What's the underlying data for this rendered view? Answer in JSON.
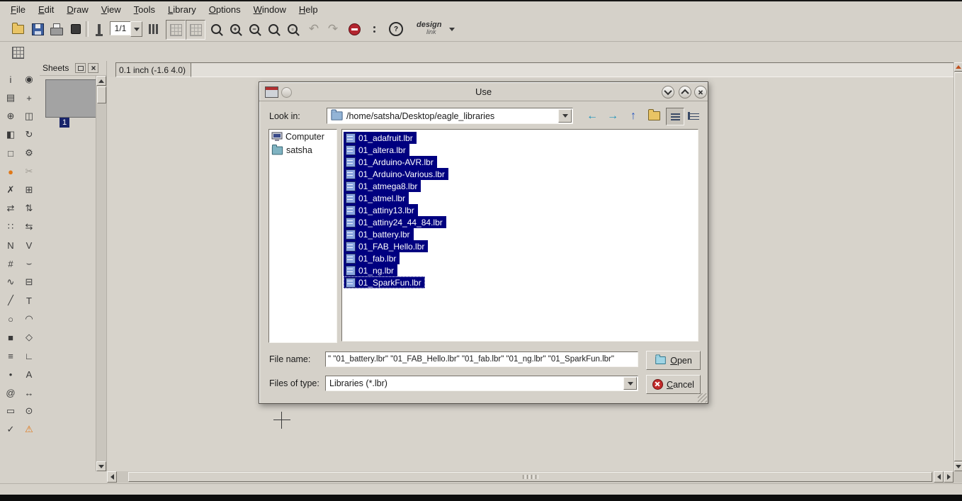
{
  "app": {
    "menubar": [
      "File",
      "Edit",
      "Draw",
      "View",
      "Tools",
      "Library",
      "Options",
      "Window",
      "Help"
    ],
    "toolbar": {
      "sheet_combo": "1/1",
      "zoom_subs": {
        "fit": "",
        "in": "+",
        "out": "−",
        "select": "▫",
        "redraw": ""
      },
      "undo_glyph": "↶",
      "redo_glyph": "↷",
      "help_glyph": "?",
      "brand_line1": "design",
      "brand_line2": "link"
    },
    "sheets_panel": {
      "title": "Sheets",
      "sheet_number": "1"
    },
    "command_bar": {
      "coordinates": "0.1 inch (-1.6 4.0)",
      "command_value": ""
    },
    "palette_tools": [
      {
        "name": "info-tool",
        "glyph": "i"
      },
      {
        "name": "show-tool",
        "glyph": "◉"
      },
      {
        "name": "display-tool",
        "glyph": "▤"
      },
      {
        "name": "mark-tool",
        "glyph": "+"
      },
      {
        "name": "move-tool",
        "glyph": "⊕"
      },
      {
        "name": "copy-tool",
        "glyph": "◫"
      },
      {
        "name": "mirror-tool",
        "glyph": "◧"
      },
      {
        "name": "rotate-tool",
        "glyph": "↻"
      },
      {
        "name": "group-tool",
        "glyph": "□"
      },
      {
        "name": "change-tool",
        "glyph": "⚙"
      },
      {
        "name": "paint-tool",
        "glyph": "●",
        "color": "#e07818"
      },
      {
        "name": "cut-tool",
        "glyph": "✂",
        "disabled": true
      },
      {
        "name": "delete-tool",
        "glyph": "✗"
      },
      {
        "name": "add-tool",
        "glyph": "⊞"
      },
      {
        "name": "pinswap-tool",
        "glyph": "⇄"
      },
      {
        "name": "gateswap-tool",
        "glyph": "⇅"
      },
      {
        "name": "array-tool",
        "glyph": "∷"
      },
      {
        "name": "replace-tool",
        "glyph": "⇆"
      },
      {
        "name": "name-tool",
        "glyph": "N"
      },
      {
        "name": "value-tool",
        "glyph": "V"
      },
      {
        "name": "smash-tool",
        "glyph": "#"
      },
      {
        "name": "miter-tool",
        "glyph": "⌣"
      },
      {
        "name": "split-tool",
        "glyph": "∿"
      },
      {
        "name": "invoke-tool",
        "glyph": "⊟"
      },
      {
        "name": "wire-tool",
        "glyph": "╱"
      },
      {
        "name": "text-tool",
        "glyph": "T"
      },
      {
        "name": "circle-tool",
        "glyph": "○"
      },
      {
        "name": "arc-tool",
        "glyph": "◠"
      },
      {
        "name": "rect-tool",
        "glyph": "■"
      },
      {
        "name": "polygon-tool",
        "glyph": "◇"
      },
      {
        "name": "bus-tool",
        "glyph": "≡"
      },
      {
        "name": "net-tool",
        "glyph": "∟"
      },
      {
        "name": "junction-tool",
        "glyph": "•"
      },
      {
        "name": "label-tool",
        "glyph": "A"
      },
      {
        "name": "attribute-tool",
        "glyph": "@"
      },
      {
        "name": "dimension-tool",
        "glyph": "↔"
      },
      {
        "name": "frame-tool",
        "glyph": "▭"
      },
      {
        "name": "port-tool",
        "glyph": "⊙"
      },
      {
        "name": "erc-tool",
        "glyph": "✓"
      },
      {
        "name": "errors-tool",
        "glyph": "⚠",
        "color": "#e07818"
      }
    ]
  },
  "dialog": {
    "title": "Use",
    "look_in": {
      "label": "Look in:",
      "value": "/home/satsha/Desktop/eagle_libraries"
    },
    "nav_glyphs": {
      "back": "←",
      "forward": "→",
      "up": "↑"
    },
    "places": [
      {
        "name": "Computer"
      },
      {
        "name": "satsha"
      }
    ],
    "files": [
      {
        "name": "01_adafruit.lbr",
        "selected": true
      },
      {
        "name": "01_altera.lbr",
        "selected": true
      },
      {
        "name": "01_Arduino-AVR.lbr",
        "selected": true
      },
      {
        "name": "01_Arduino-Various.lbr",
        "selected": true
      },
      {
        "name": "01_atmega8.lbr",
        "selected": true
      },
      {
        "name": "01_atmel.lbr",
        "selected": true
      },
      {
        "name": "01_attiny13.lbr",
        "selected": true
      },
      {
        "name": "01_attiny24_44_84.lbr",
        "selected": true
      },
      {
        "name": "01_battery.lbr",
        "selected": true
      },
      {
        "name": "01_FAB_Hello.lbr",
        "selected": true
      },
      {
        "name": "01_fab.lbr",
        "selected": true
      },
      {
        "name": "01_ng.lbr",
        "selected": true
      },
      {
        "name": "01_SparkFun.lbr",
        "selected": true,
        "focused": true
      }
    ],
    "file_name": {
      "label": "File name:",
      "value": "\" \"01_battery.lbr\" \"01_FAB_Hello.lbr\" \"01_fab.lbr\" \"01_ng.lbr\" \"01_SparkFun.lbr\""
    },
    "files_of_type": {
      "label": "Files of type:",
      "value": "Libraries (*.lbr)"
    },
    "buttons": {
      "open": "Open",
      "cancel": "Cancel"
    }
  }
}
